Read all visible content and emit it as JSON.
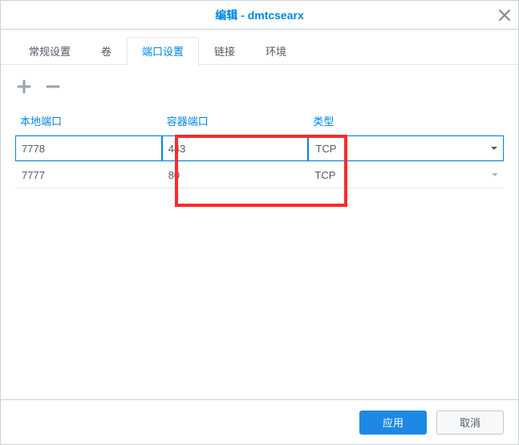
{
  "title": "编辑 - dmtcsearx",
  "tabs": {
    "general": "常规设置",
    "volume": "卷",
    "port": "端口设置",
    "links": "链接",
    "env": "环境"
  },
  "active_tab": "port",
  "columns": {
    "local_port": "本地端口",
    "container_port": "容器端口",
    "type": "类型"
  },
  "rows": [
    {
      "local": "7778",
      "container": "443",
      "type": "TCP",
      "active": true
    },
    {
      "local": "7777",
      "container": "80",
      "type": "TCP",
      "active": false
    }
  ],
  "footer": {
    "apply": "应用",
    "cancel": "取消"
  }
}
